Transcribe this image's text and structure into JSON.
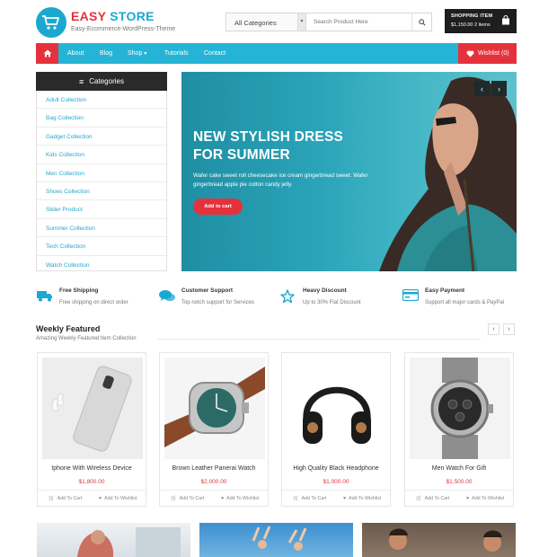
{
  "header": {
    "logo_word1": "EASY",
    "logo_word2": "STORE",
    "tagline": "Easy-Ecommerce-WordPress-Theme",
    "search": {
      "category": "All Categories",
      "placeholder": "Search Product Here"
    },
    "cart": {
      "label": "SHOPPING ITEM",
      "value": "$1,150.00 2 items"
    }
  },
  "nav": {
    "items": [
      "About",
      "Blog",
      "Shop",
      "Tutorials",
      "Contact"
    ],
    "wishlist": "Wishlist (0)"
  },
  "categories": {
    "title": "Categories",
    "items": [
      "Adult Collection",
      "Bag Collection",
      "Gadget Collection",
      "Kids Collection",
      "Men Collection",
      "Shoes Collection",
      "Slider Product",
      "Summer Collection",
      "Tech Collection",
      "Watch Collection"
    ]
  },
  "hero": {
    "title_line1": "NEW STYLISH DRESS",
    "title_line2": "FOR SUMMER",
    "desc": "Wafer cake sweet roll cheesecake ice cream gingerbread sweet. Wafer gingerbread apple pie cotton candy jelly.",
    "cta": "Add to cart"
  },
  "features": [
    {
      "icon": "truck-icon",
      "title": "Free Shipping",
      "desc": "Free shipping on direct order"
    },
    {
      "icon": "chat-icon",
      "title": "Customer Support",
      "desc": "Top notch support for Services"
    },
    {
      "icon": "star-icon",
      "title": "Heavy Discount",
      "desc": "Up to 30% Flat Discount"
    },
    {
      "icon": "card-icon",
      "title": "Easy Payment",
      "desc": "Support all major cards & PayPal"
    }
  ],
  "weekly": {
    "title": "Weekly Featured",
    "subtitle": "Amazing Weekly Featured Item Collection",
    "add_label": "Add To Cart",
    "wish_label": "Add To Wishlist",
    "products": [
      {
        "name": "Iphone With Wireless Device",
        "price": "$1,800.00"
      },
      {
        "name": "Brown Leather Panerai Watch",
        "price": "$2,000.00"
      },
      {
        "name": "High Quality Black Headphone",
        "price": "$1,000.00"
      },
      {
        "name": "Men Watch For Gift",
        "price": "$1,500.00"
      }
    ]
  },
  "colors": {
    "accent_red": "#e4323c",
    "accent_blue": "#26b4d6",
    "dark": "#1e1e1e"
  }
}
